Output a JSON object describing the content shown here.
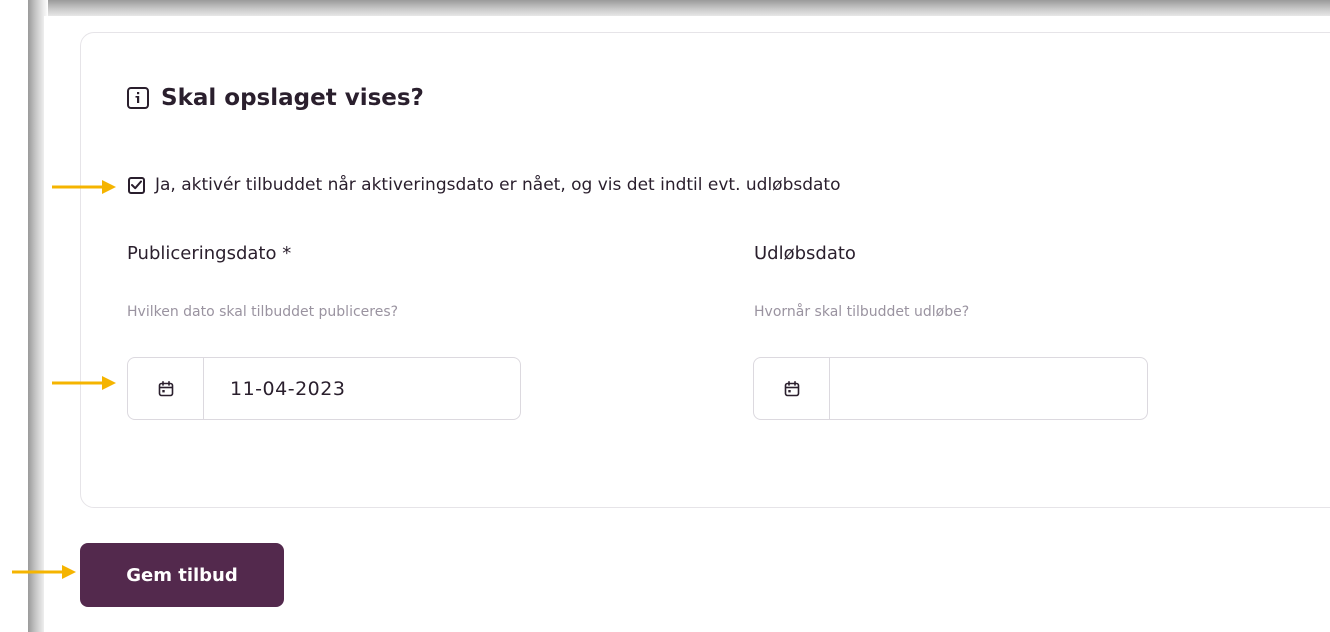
{
  "section": {
    "title": "Skal opslaget vises?",
    "icon": "info-icon"
  },
  "activation": {
    "checked": true,
    "label": "Ja, aktivér tilbuddet når aktiveringsdato er nået, og vis det indtil evt. udløbsdato"
  },
  "publish_date": {
    "label": "Publiceringsdato",
    "required_marker": "*",
    "help": "Hvilken dato skal tilbuddet publiceres?",
    "value": "11-04-2023",
    "icon": "calendar-icon"
  },
  "expiry_date": {
    "label": "Udløbsdato",
    "help": "Hvornår skal tilbuddet udløbe?",
    "value": "",
    "icon": "calendar-icon"
  },
  "save_button": {
    "label": "Gem tilbud"
  },
  "colors": {
    "accent": "#53294d",
    "annotation_arrow": "#f5b400",
    "text": "#2a1f2d",
    "muted_text": "#9a93a0"
  }
}
